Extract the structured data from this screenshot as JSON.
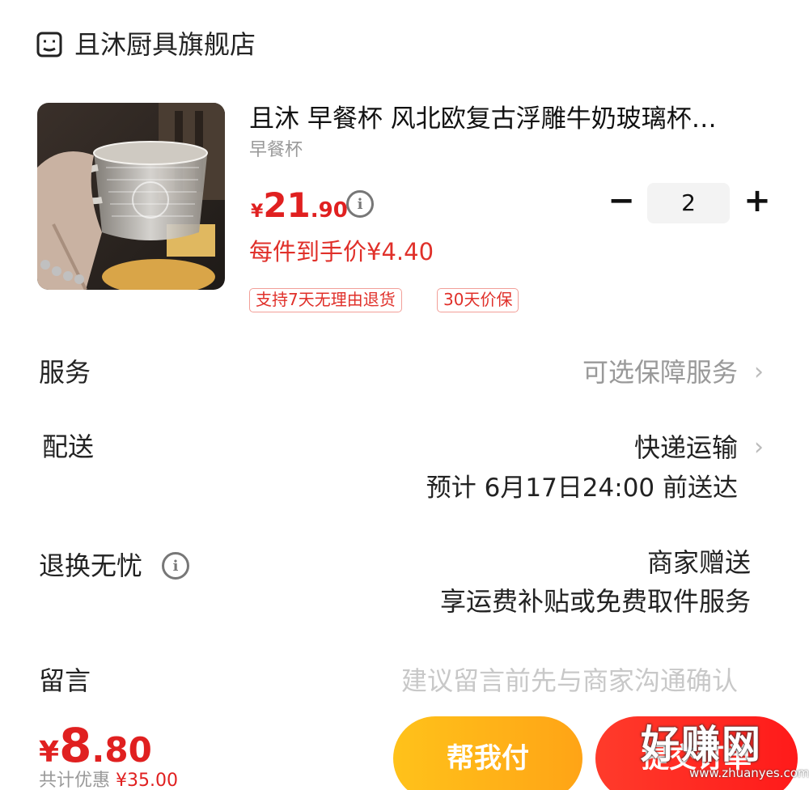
{
  "store": {
    "name": "且沐厨具旗舰店",
    "icon": "store-icon"
  },
  "product": {
    "title": "且沐 早餐杯 风北欧复古浮雕牛奶玻璃杯…",
    "spec": "早餐杯",
    "price_currency": "¥",
    "price_int": "21",
    "price_dec": ".90",
    "unit_price": "每件到手价¥4.40",
    "tags": [
      "支持7天无理由退货",
      "30天价保"
    ],
    "quantity": "2",
    "minus_label": "−",
    "plus_label": "+"
  },
  "rows": {
    "service": {
      "label": "服务",
      "value": "可选保障服务",
      "chevron": "›"
    },
    "delivery": {
      "label": "配送",
      "value": "快递运输",
      "detail": "预计 6月17日24:00 前送达",
      "chevron": "›"
    },
    "returns": {
      "label": "退换无忧",
      "value": "商家赠送",
      "detail": "享运费补贴或免费取件服务"
    },
    "message": {
      "label": "留言",
      "placeholder": "建议留言前先与商家沟通确认"
    }
  },
  "footer": {
    "currency": "¥",
    "total_int": "8",
    "total_dec": ".80",
    "discount_label": "共计优惠",
    "discount_amount": "¥35.00",
    "help_pay_label": "帮我付",
    "pay_label": "提交订单"
  },
  "watermark": {
    "text": "好赚网",
    "url": "www.zhuanyes.com"
  },
  "colors": {
    "price_red": "#e02020",
    "help_btn": "#ffb31a",
    "pay_btn": "#ff2a20"
  }
}
